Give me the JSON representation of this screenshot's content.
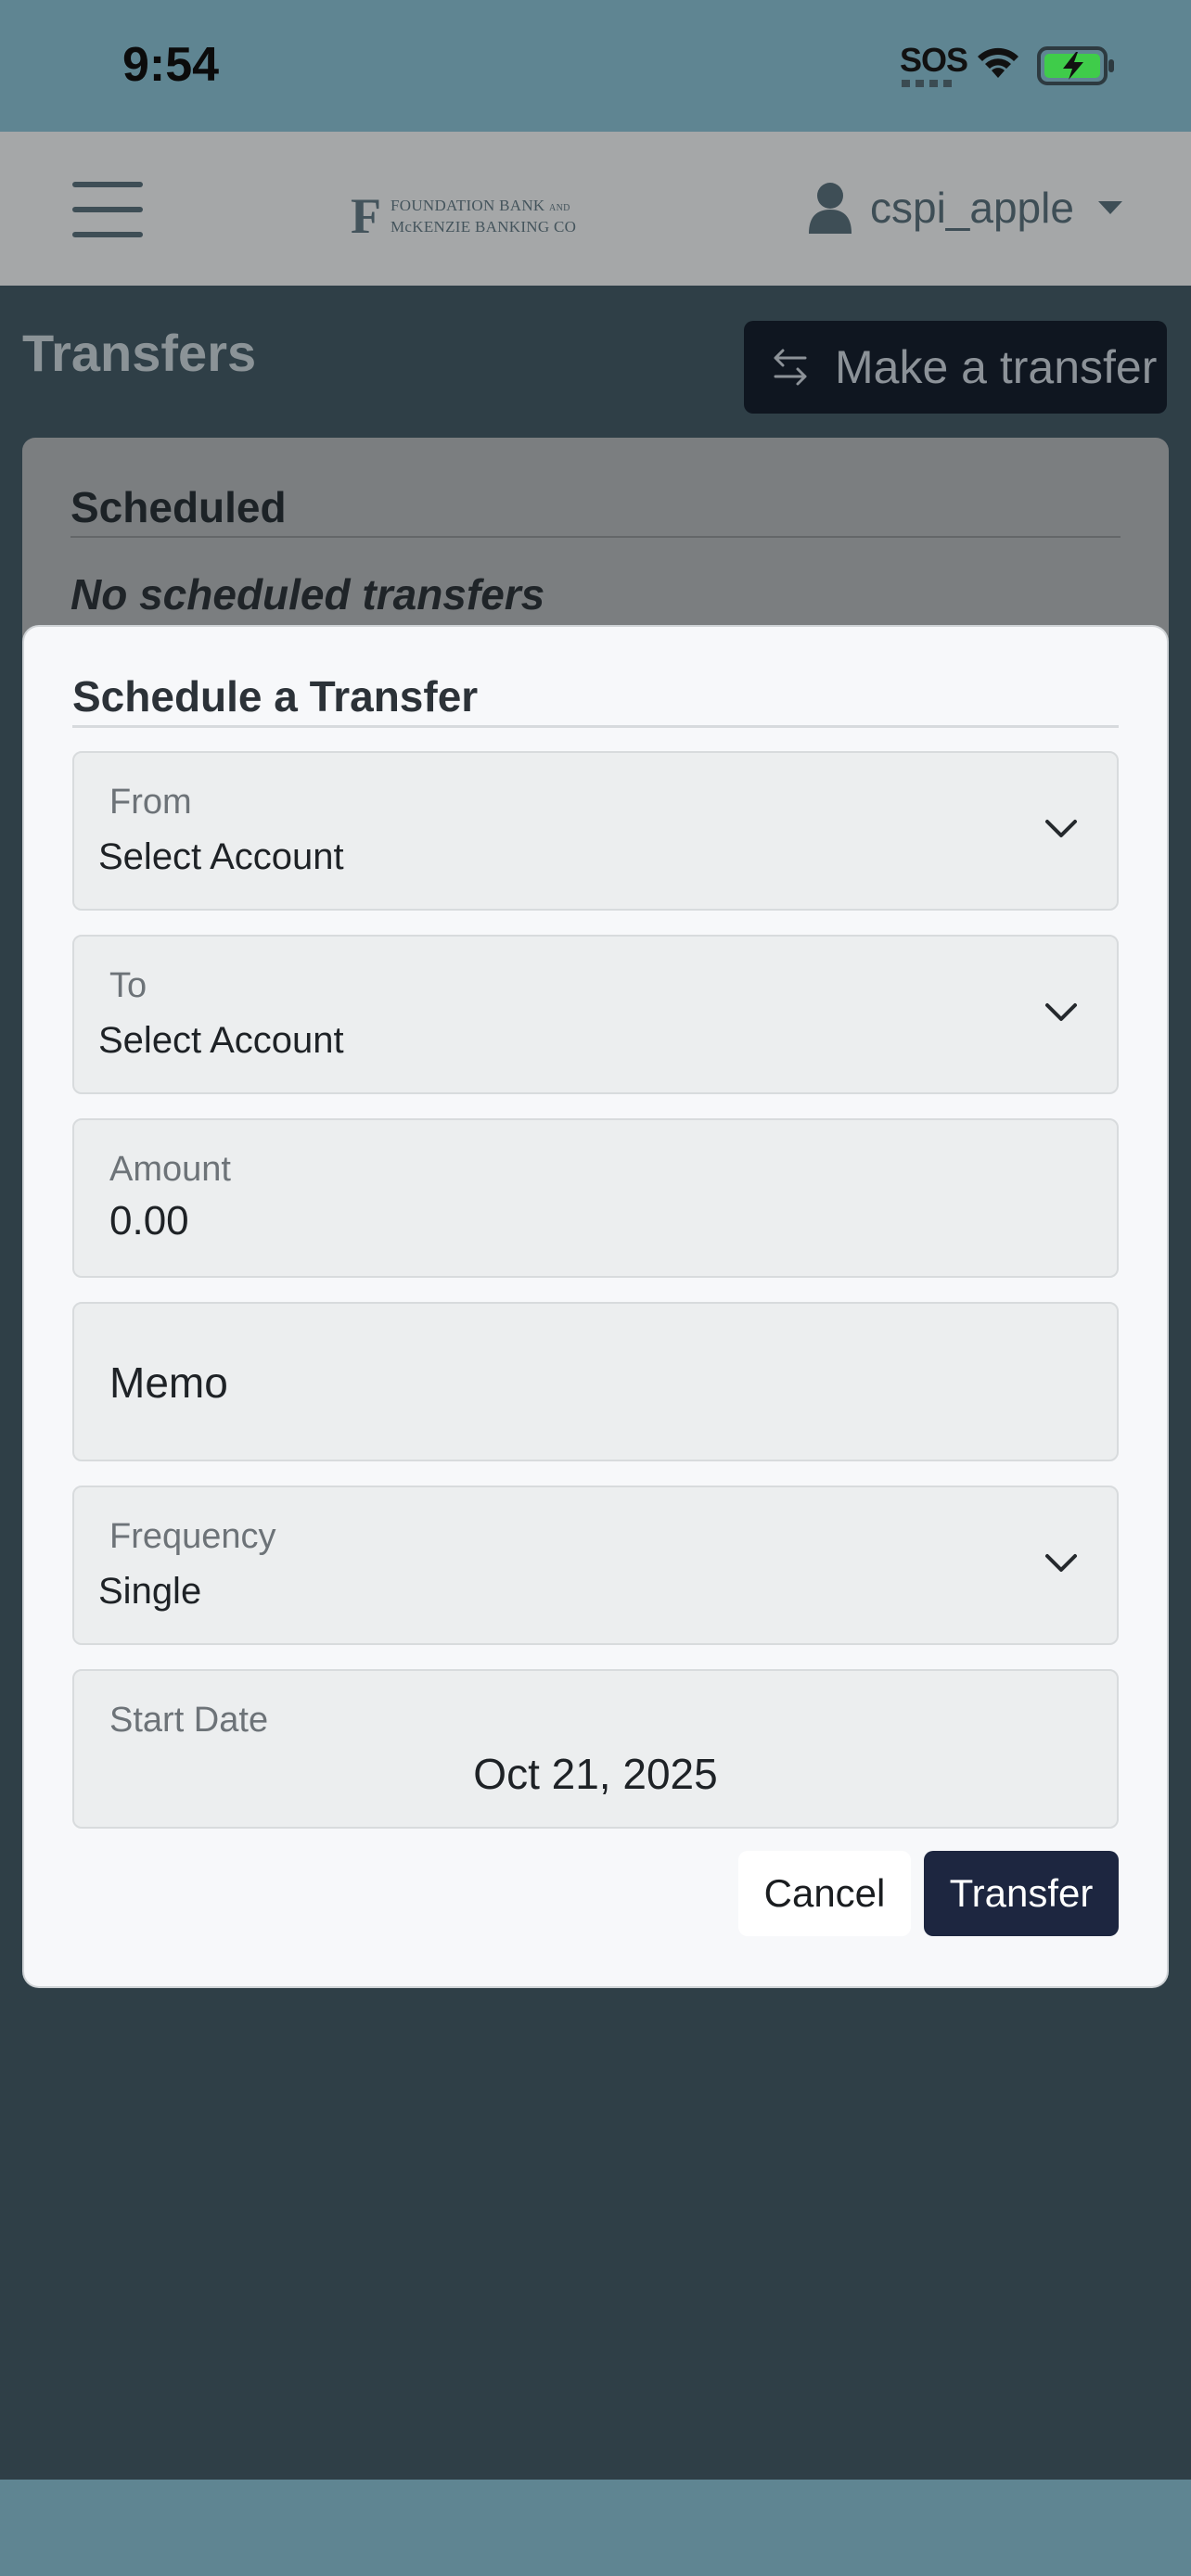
{
  "status_bar": {
    "time": "9:54",
    "sos": "SOS"
  },
  "header": {
    "logo_line1": "FOUNDATION BANK",
    "logo_line1_suffix": "AND",
    "logo_line2": "McKENZIE BANKING CO",
    "username": "cspi_apple"
  },
  "page": {
    "title": "Transfers",
    "make_transfer_label": "Make a transfer"
  },
  "scheduled": {
    "title": "Scheduled",
    "empty_text": "No scheduled transfers"
  },
  "modal": {
    "title": "Schedule a Transfer",
    "from": {
      "label": "From",
      "value": "Select Account"
    },
    "to": {
      "label": "To",
      "value": "Select Account"
    },
    "amount": {
      "label": "Amount",
      "value": "0.00"
    },
    "memo": {
      "placeholder": "Memo"
    },
    "frequency": {
      "label": "Frequency",
      "value": "Single"
    },
    "start_date": {
      "label": "Start Date",
      "value": "Oct 21, 2025"
    },
    "cancel_label": "Cancel",
    "transfer_label": "Transfer"
  },
  "colors": {
    "brand_navy": "#1d2640",
    "status_bar": "#5f8592",
    "overlay_bg": "#2f3f47"
  }
}
